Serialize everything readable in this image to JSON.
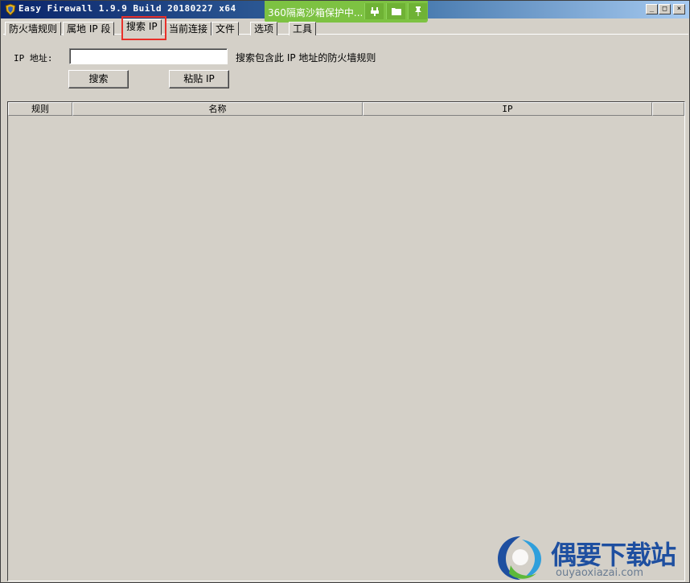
{
  "window": {
    "title": "Easy Firewall 1.9.9 Build 20180227 x64",
    "min_label": "_",
    "max_label": "□",
    "close_label": "×"
  },
  "sandbox": {
    "text": "360隔离沙箱保护中...",
    "icons": [
      "plug-icon",
      "folder-icon",
      "pin-icon"
    ]
  },
  "tabs": [
    {
      "label": "防火墙规则"
    },
    {
      "label": "属地 IP 段"
    },
    {
      "label": "搜索 IP",
      "active": true
    },
    {
      "label": "当前连接"
    },
    {
      "label": "文件"
    },
    {
      "label": "选项"
    },
    {
      "label": "工具"
    }
  ],
  "search": {
    "ip_label": "IP 地址:",
    "ip_value": "",
    "hint": "搜索包含此 IP 地址的防火墙规则",
    "search_button": "搜索",
    "paste_button": "粘贴 IP"
  },
  "results": {
    "columns": [
      "规则",
      "名称",
      "IP"
    ],
    "rows": []
  },
  "watermark": {
    "text": "偶要下载站",
    "url": "ouyaoxiazai.com"
  },
  "colors": {
    "highlight": "#e8302a",
    "sandbox": "#7dc242",
    "watermark": "#1e4fa0"
  }
}
